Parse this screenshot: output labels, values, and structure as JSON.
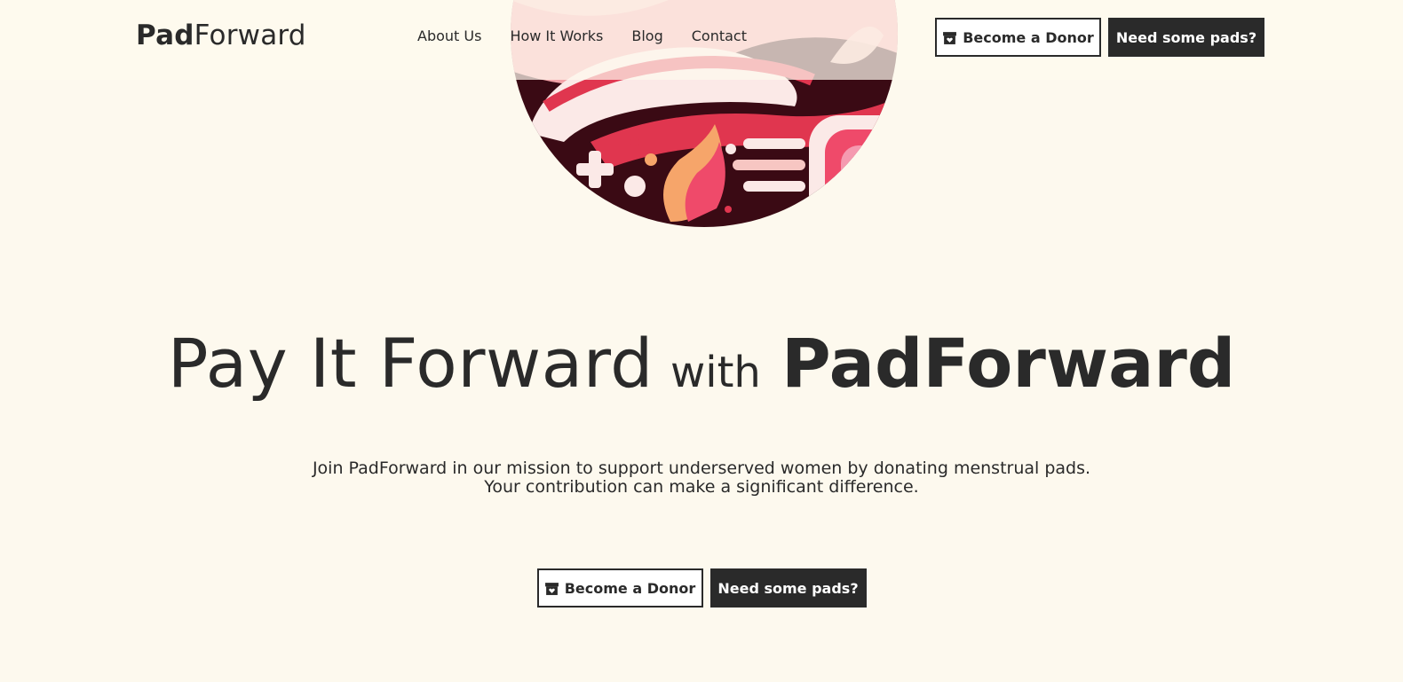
{
  "header": {
    "logo": {
      "bold": "Pad",
      "light": "Forward"
    },
    "nav": [
      {
        "label": "About Us"
      },
      {
        "label": "How It Works"
      },
      {
        "label": "Blog"
      },
      {
        "label": "Contact"
      }
    ],
    "donor_button": {
      "label": "Become a Donor",
      "icon": "gift-box-icon"
    },
    "pads_button": {
      "label": "Need some pads?"
    }
  },
  "hero": {
    "image": "hands-and-pads-illustration",
    "headline": {
      "main": "Pay It Forward",
      "connector": "with",
      "brand": "PadForward"
    },
    "subtitle": [
      "Join PadForward in our mission to support underserved women by donating menstrual pads.",
      "Your contribution can make a significant difference."
    ],
    "donor_button": {
      "label": "Become a Donor",
      "icon": "gift-box-icon"
    },
    "pads_button": {
      "label": "Need some pads?"
    }
  },
  "colors": {
    "background": "#fdf9ee",
    "text": "#2a2a2a",
    "accent_pink": "#ef4a6a",
    "accent_dark": "#3a0a14"
  }
}
